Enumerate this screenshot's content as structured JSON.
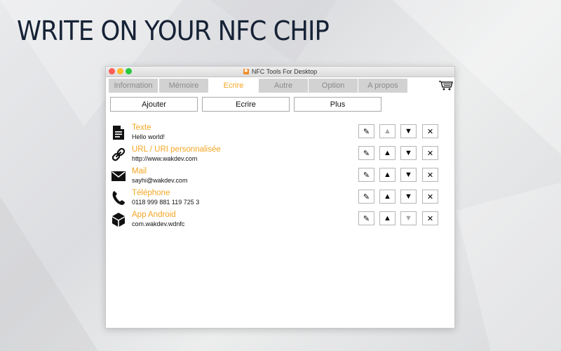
{
  "headline": "WRITE ON YOUR NFC CHIP",
  "window": {
    "title": "NFC Tools For Desktop",
    "tabs": [
      {
        "label": "Information",
        "active": false
      },
      {
        "label": "Mémoire",
        "active": false
      },
      {
        "label": "Ecrire",
        "active": true
      },
      {
        "label": "Autre",
        "active": false
      },
      {
        "label": "Option",
        "active": false
      },
      {
        "label": "A propos",
        "active": false
      }
    ],
    "cart_icon": "shopping-cart-icon",
    "actions": {
      "add": "Ajouter",
      "write": "Ecrire",
      "more": "Plus"
    },
    "records": [
      {
        "icon": "document-icon",
        "title": "Texte",
        "value": "Hello world!",
        "up_enabled": false,
        "down_enabled": true
      },
      {
        "icon": "link-icon",
        "title": "URL / URI personnalisée",
        "value": "http://www.wakdev.com",
        "up_enabled": true,
        "down_enabled": true
      },
      {
        "icon": "envelope-icon",
        "title": "Mail",
        "value": "sayhi@wakdev.com",
        "up_enabled": true,
        "down_enabled": true
      },
      {
        "icon": "phone-icon",
        "title": "Téléphone",
        "value": "0118 999 881 119 725 3",
        "up_enabled": true,
        "down_enabled": true
      },
      {
        "icon": "package-icon",
        "title": "App Android",
        "value": "com.wakdev.wdnfc",
        "up_enabled": true,
        "down_enabled": false
      }
    ]
  },
  "colors": {
    "accent": "#f5a623",
    "headline": "#162236",
    "tab_inactive_bg": "#d2d2d2",
    "tab_inactive_text": "#8a8a8a"
  }
}
